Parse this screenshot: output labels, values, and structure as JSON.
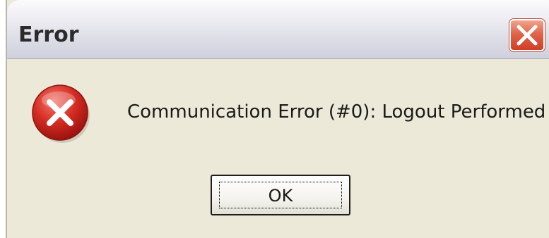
{
  "window": {
    "title": "Error",
    "close_icon": "close-x-icon"
  },
  "dialog": {
    "icon": "error-icon",
    "message": "Communication Error (#0): Logout Performed",
    "ok_label": "OK"
  },
  "colors": {
    "dialog_background": "#ece9d8",
    "close_button": "#e1644a",
    "error_icon": "#d42b22"
  }
}
